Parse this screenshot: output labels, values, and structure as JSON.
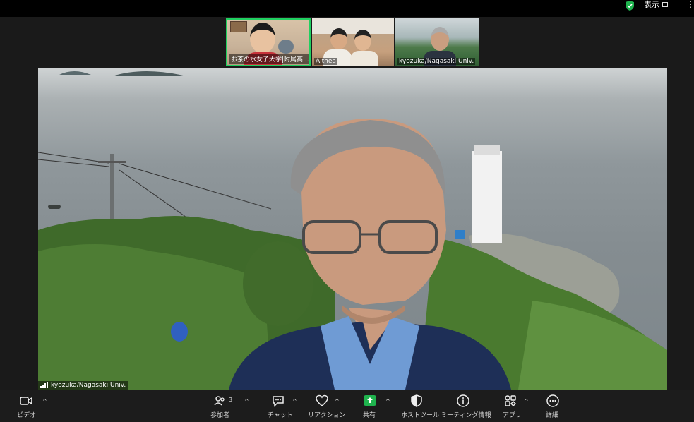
{
  "topbar": {
    "view_label": "表示"
  },
  "participants": [
    {
      "name": "お茶の水女子大学|附属高..."
    },
    {
      "name": "Althea"
    },
    {
      "name": "kyozuka/Nagasaki Univ."
    }
  ],
  "active_speaker": {
    "name": "kyozuka/Nagasaki Univ."
  },
  "toolbar": {
    "video_label": "ビデオ",
    "participants_label": "参加者",
    "participants_count": "3",
    "chat_label": "チャット",
    "reactions_label": "リアクション",
    "share_label": "共有",
    "host_tools_label": "ホストツール",
    "meeting_info_label": "ミーティング情報",
    "apps_label": "アプリ",
    "more_label": "詳細"
  },
  "colors": {
    "active_border": "#20d060",
    "share_green": "#1fb34e",
    "toolbar_bg": "#1c1c1c"
  }
}
